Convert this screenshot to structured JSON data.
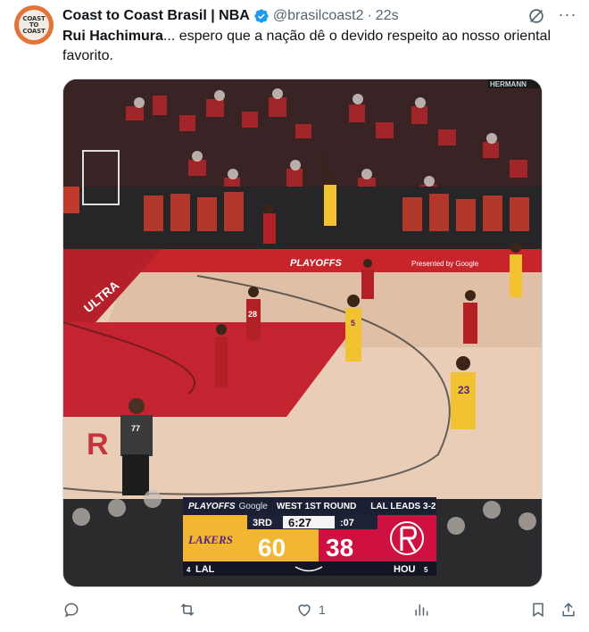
{
  "post": {
    "avatar_text": "COAST\nTO\nCOAST",
    "author_name": "Coast to Coast Brasil | NBA",
    "handle": "@brasilcoast2",
    "separator": "·",
    "time": "22s",
    "text_lead": "Rui Hachimura",
    "text_rest": "... espero que a nação dê o devido respeito ao nosso oriental favorito."
  },
  "video": {
    "arena_banner": "HERMANN",
    "court_ad_left": "ULTRA",
    "court_ad_center": "PLAYOFFS",
    "court_ad_right": "Presented by Google",
    "referee_number": "77",
    "player_numbers": [
      "23",
      "5",
      "28"
    ],
    "scorebug": {
      "playoffs": "PLAYOFFS",
      "sponsor": "Google",
      "round": "WEST 1ST ROUND",
      "series": "LAL LEADS 3-2",
      "period": "3RD",
      "clock": "6:27",
      "shot_clock": ":07",
      "home_team": "LAKERS",
      "home_score": "60",
      "away_score": "38",
      "home_abbr": "LAL",
      "away_abbr": "HOU",
      "home_seed": "4",
      "away_seed": "5"
    }
  },
  "actions": {
    "reply_count": "",
    "repost_count": "",
    "like_count": "1",
    "views_count": ""
  },
  "colors": {
    "lakers_gold": "#f2b632",
    "lakers_purple": "#552583",
    "rockets_red": "#ce1141",
    "verified_blue": "#1d9bf0",
    "text_secondary": "#536471"
  }
}
